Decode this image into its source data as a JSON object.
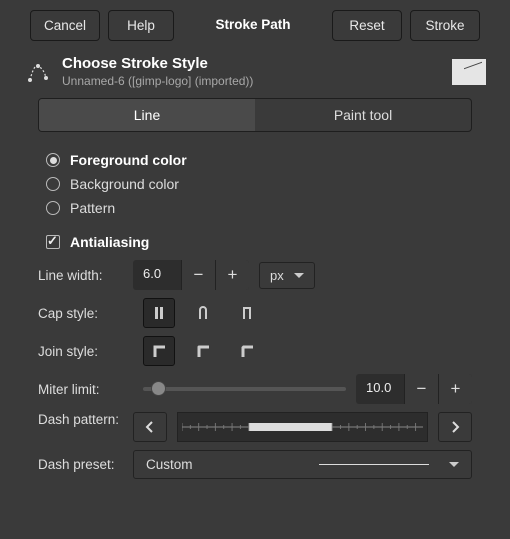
{
  "buttons": {
    "cancel": "Cancel",
    "help": "Help",
    "stroke_path": "Stroke Path",
    "reset": "Reset",
    "stroke": "Stroke"
  },
  "header": {
    "title": "Choose Stroke Style",
    "subtitle": "Unnamed-6 ([gimp-logo] (imported))"
  },
  "tabs": {
    "line": "Line",
    "paint_tool": "Paint tool"
  },
  "color_source": {
    "foreground": "Foreground color",
    "background": "Background color",
    "pattern": "Pattern"
  },
  "antialiasing": {
    "label": "Antialiasing"
  },
  "line_width": {
    "label": "Line width:",
    "value": "6.0",
    "unit": "px"
  },
  "cap_style": {
    "label": "Cap style:"
  },
  "join_style": {
    "label": "Join style:"
  },
  "miter_limit": {
    "label": "Miter limit:",
    "value": "10.0"
  },
  "dash_pattern": {
    "label": "Dash pattern:"
  },
  "dash_preset": {
    "label": "Dash preset:",
    "value": "Custom"
  }
}
